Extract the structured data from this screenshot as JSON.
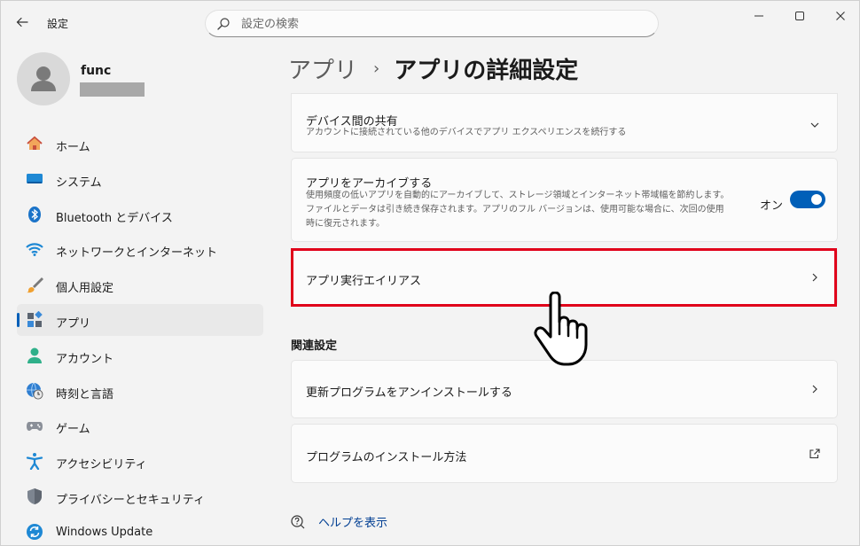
{
  "window": {
    "app_title": "設定",
    "controls": {
      "minimize": "—",
      "maximize": "☐",
      "close": "✕"
    }
  },
  "search": {
    "placeholder": "設定の検索",
    "value": ""
  },
  "profile": {
    "name": "func"
  },
  "sidebar": {
    "items": [
      {
        "label": "ホーム",
        "icon": "home-icon"
      },
      {
        "label": "システム",
        "icon": "system-icon"
      },
      {
        "label": "Bluetooth とデバイス",
        "icon": "bluetooth-icon"
      },
      {
        "label": "ネットワークとインターネット",
        "icon": "wifi-icon"
      },
      {
        "label": "個人用設定",
        "icon": "brush-icon"
      },
      {
        "label": "アプリ",
        "icon": "apps-icon",
        "selected": true
      },
      {
        "label": "アカウント",
        "icon": "account-icon"
      },
      {
        "label": "時刻と言語",
        "icon": "globe-clock-icon"
      },
      {
        "label": "ゲーム",
        "icon": "gamepad-icon"
      },
      {
        "label": "アクセシビリティ",
        "icon": "accessibility-icon"
      },
      {
        "label": "プライバシーとセキュリティ",
        "icon": "shield-icon"
      },
      {
        "label": "Windows Update",
        "icon": "update-icon"
      }
    ]
  },
  "breadcrumb": {
    "parent": "アプリ",
    "separator": "›",
    "current": "アプリの詳細設定"
  },
  "cards": {
    "share": {
      "title": "デバイス間の共有",
      "description": "アカウントに接続されている他のデバイスでアプリ エクスペリエンスを続行する"
    },
    "archive": {
      "title": "アプリをアーカイブする",
      "description": "使用頻度の低いアプリを自動的にアーカイブして、ストレージ領域とインターネット帯域幅を節約します。ファイルとデータは引き続き保存されます。アプリのフル バージョンは、使用可能な場合に、次回の使用時に復元されます。",
      "toggle_label": "オン",
      "toggle_on": true
    },
    "alias": {
      "title": "アプリ実行エイリアス"
    }
  },
  "related": {
    "section_title": "関連設定",
    "uninstall_updates": "更新プログラムをアンインストールする",
    "install_method": "プログラムのインストール方法"
  },
  "help": {
    "label": "ヘルプを表示"
  },
  "colors": {
    "accent": "#005fb8",
    "highlight": "#e0001a",
    "link": "#003e92"
  }
}
